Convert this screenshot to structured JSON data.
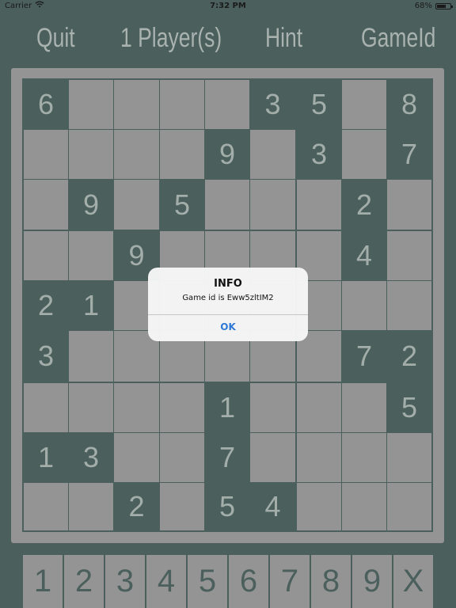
{
  "status_bar": {
    "carrier": "Carrier",
    "time": "7:32 PM",
    "battery": "68%",
    "battery_level": 0.68
  },
  "menu": {
    "quit": "Quit",
    "players": "1 Player(s)",
    "hint": "Hint",
    "gameid": "GameId"
  },
  "board": {
    "rows": [
      [
        "6",
        "",
        "",
        "",
        "",
        "3",
        "5",
        "",
        "8"
      ],
      [
        "",
        "",
        "",
        "",
        "9",
        "",
        "3",
        "",
        "7"
      ],
      [
        "",
        "9",
        "",
        "5",
        "",
        "",
        "",
        "2",
        ""
      ],
      [
        "",
        "",
        "9",
        "",
        "",
        "",
        "",
        "4",
        ""
      ],
      [
        "2",
        "1",
        "",
        "",
        "",
        "",
        "",
        "",
        ""
      ],
      [
        "3",
        "",
        "",
        "",
        "",
        "",
        "",
        "7",
        "2"
      ],
      [
        "",
        "",
        "",
        "",
        "1",
        "",
        "",
        "",
        "5"
      ],
      [
        "1",
        "3",
        "",
        "",
        "7",
        "",
        "",
        "",
        ""
      ],
      [
        "",
        "",
        "2",
        "",
        "5",
        "4",
        "",
        "",
        ""
      ]
    ]
  },
  "alert": {
    "title": "INFO",
    "message": "Game id is Eww5zltIM2",
    "button": "OK"
  },
  "numpad": {
    "keys": [
      "1",
      "2",
      "3",
      "4",
      "5",
      "6",
      "7",
      "8",
      "9",
      "X"
    ]
  },
  "colors": {
    "background": "#4b605c",
    "empty_cell": "#949494",
    "menu_text": "#a9b2af",
    "alert_button": "#2f79d6"
  },
  "icons": {
    "wifi": "wifi-icon",
    "battery": "battery-icon"
  }
}
